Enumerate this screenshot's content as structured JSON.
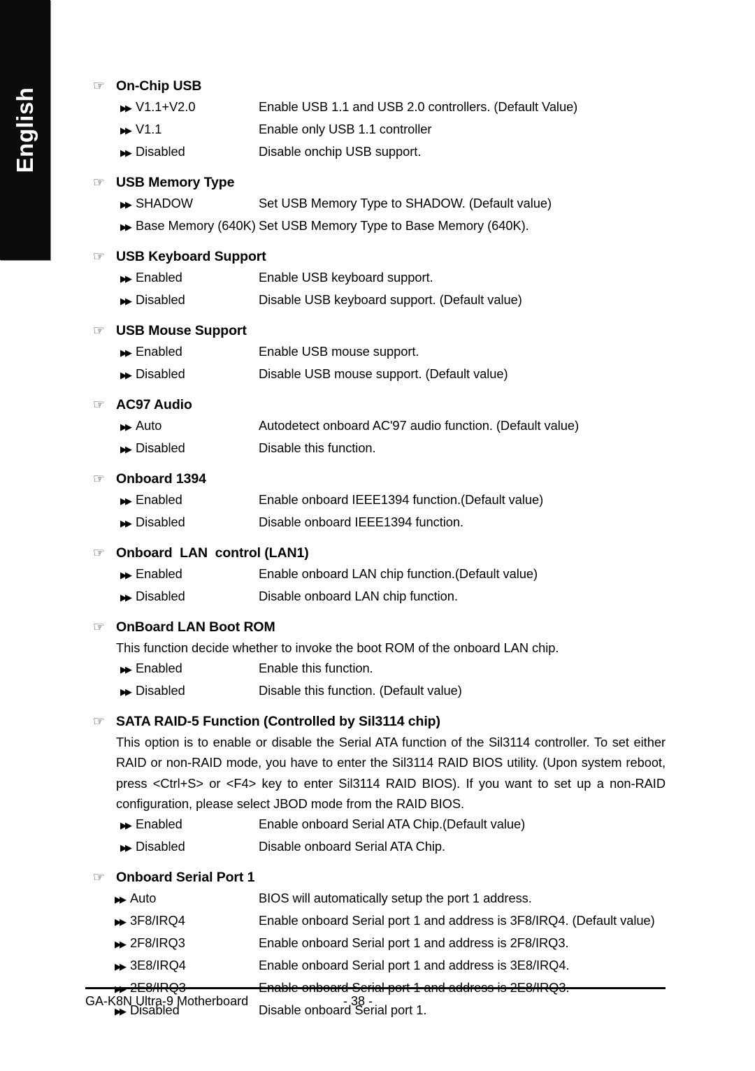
{
  "sidebar": {
    "language_tab": "English"
  },
  "page": {
    "footer_left": "GA-K8N Ultra-9 Motherboard",
    "footer_center": "- 38 -"
  },
  "icons": {
    "section_bullet": "☞",
    "option_bullet": "▶▶"
  },
  "sections": [
    {
      "title": "On-Chip USB",
      "paragraph": null,
      "options": [
        {
          "name": "V1.1+V2.0",
          "desc": "Enable USB 1.1 and USB 2.0 controllers. (Default Value)"
        },
        {
          "name": "V1.1",
          "desc": "Enable only USB 1.1 controller"
        },
        {
          "name": "Disabled",
          "desc": "Disable onchip USB support."
        }
      ]
    },
    {
      "title": "USB Memory Type",
      "paragraph": null,
      "options": [
        {
          "name": "SHADOW",
          "desc": "Set USB Memory Type to SHADOW. (Default value)"
        },
        {
          "name": "Base Memory (640K)",
          "desc": "Set USB Memory Type to Base Memory (640K)."
        }
      ]
    },
    {
      "title": "USB Keyboard Support",
      "paragraph": null,
      "options": [
        {
          "name": "Enabled",
          "desc": "Enable USB keyboard support."
        },
        {
          "name": "Disabled",
          "desc": "Disable USB keyboard support. (Default value)"
        }
      ]
    },
    {
      "title": "USB Mouse Support",
      "paragraph": null,
      "options": [
        {
          "name": "Enabled",
          "desc": "Enable USB mouse support."
        },
        {
          "name": "Disabled",
          "desc": "Disable USB mouse support. (Default value)"
        }
      ]
    },
    {
      "title": "AC97 Audio",
      "paragraph": null,
      "options": [
        {
          "name": "Auto",
          "desc": "Autodetect onboard AC'97 audio function. (Default value)"
        },
        {
          "name": "Disabled",
          "desc": "Disable this function."
        }
      ]
    },
    {
      "title": "Onboard 1394",
      "paragraph": null,
      "options": [
        {
          "name": "Enabled",
          "desc": "Enable onboard IEEE1394 function.(Default value)"
        },
        {
          "name": "Disabled",
          "desc": "Disable onboard IEEE1394 function."
        }
      ]
    },
    {
      "title": "Onboard  LAN  control (LAN1)",
      "paragraph": null,
      "options": [
        {
          "name": "Enabled",
          "desc": "Enable onboard LAN chip function.(Default value)"
        },
        {
          "name": "Disabled",
          "desc": "Disable onboard LAN chip function."
        }
      ]
    },
    {
      "title": "OnBoard LAN Boot ROM",
      "paragraph": "This function decide whether to invoke the boot ROM of the onboard LAN chip.",
      "options": [
        {
          "name": "Enabled",
          "desc": "Enable this function."
        },
        {
          "name": "Disabled",
          "desc": "Disable this function. (Default value)"
        }
      ]
    },
    {
      "title": "SATA RAID-5 Function (Controlled by Sil3114 chip)",
      "paragraph": "This option is to enable or disable the Serial ATA function of the Sil3114 controller. To set either RAID or non-RAID mode, you have to enter the Sil3114 RAID BIOS utility. (Upon system reboot, press <Ctrl+S> or <F4> key to enter Sil3114 RAID BIOS). If you want to set up a non-RAID configuration, please select JBOD mode from the RAID BIOS.",
      "options": [
        {
          "name": "Enabled",
          "desc": "Enable onboard Serial ATA Chip.(Default value)"
        },
        {
          "name": "Disabled",
          "desc": "Disable onboard Serial ATA Chip."
        }
      ]
    },
    {
      "title": "Onboard Serial Port 1",
      "paragraph": null,
      "tight": true,
      "options": [
        {
          "name": "Auto",
          "desc": "BIOS will automatically setup the port 1 address."
        },
        {
          "name": "3F8/IRQ4",
          "desc": "Enable onboard Serial port 1 and address is 3F8/IRQ4. (Default value)"
        },
        {
          "name": "2F8/IRQ3",
          "desc": "Enable onboard Serial port 1 and address is 2F8/IRQ3."
        },
        {
          "name": "3E8/IRQ4",
          "desc": "Enable onboard Serial port 1 and address is 3E8/IRQ4."
        },
        {
          "name": "2E8/IRQ3",
          "desc": "Enable onboard Serial port 1 and address is 2E8/IRQ3."
        },
        {
          "name": "Disabled",
          "desc": "Disable onboard Serial port 1."
        }
      ]
    }
  ]
}
